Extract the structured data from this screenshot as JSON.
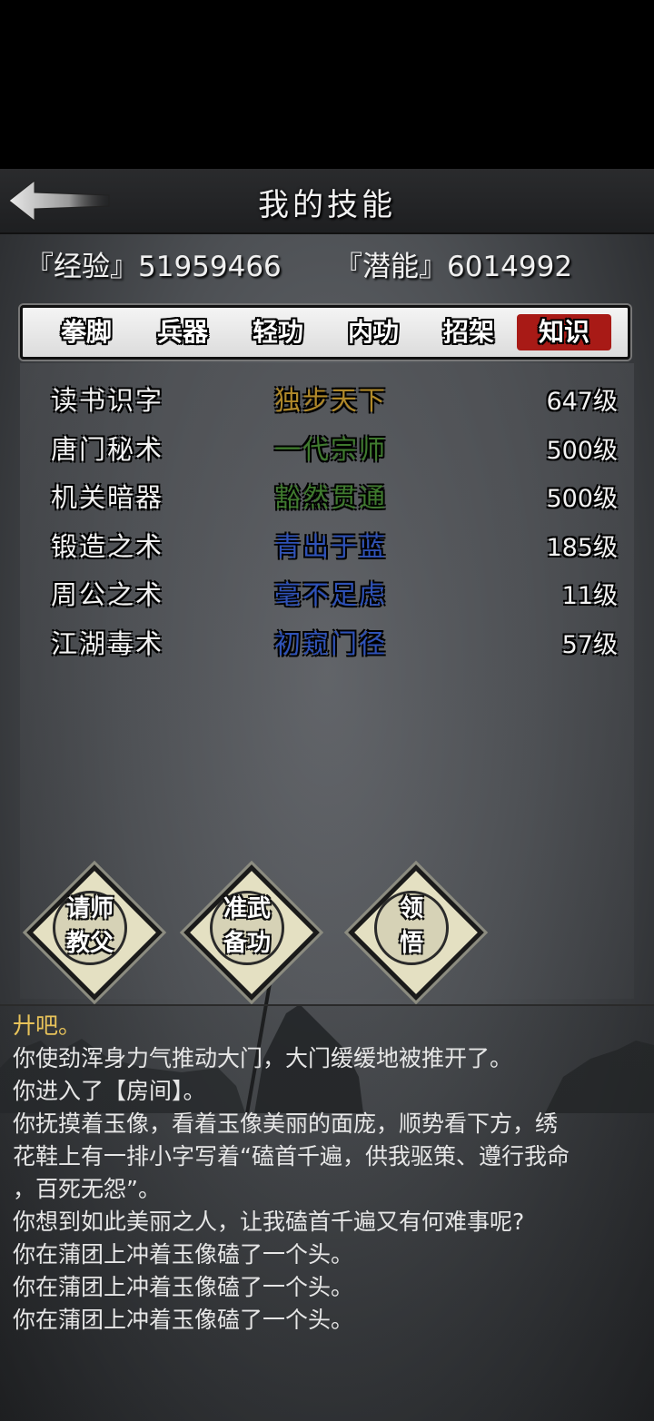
{
  "header": {
    "title": "我的技能"
  },
  "stats": {
    "experience": "『经验』51959466",
    "potential": "『潜能』6014992"
  },
  "tabs": [
    {
      "label": "拳脚",
      "active": false
    },
    {
      "label": "兵器",
      "active": false
    },
    {
      "label": "轻功",
      "active": false
    },
    {
      "label": "内功",
      "active": false
    },
    {
      "label": "招架",
      "active": false
    },
    {
      "label": "知识",
      "active": true
    }
  ],
  "skills": [
    {
      "name": "读书识字",
      "rank": "独步天下",
      "rank_color": "#b0892a",
      "level": "647级"
    },
    {
      "name": "唐门秘术",
      "rank": "一代宗师",
      "rank_color": "#3f7a2e",
      "level": "500级"
    },
    {
      "name": "机关暗器",
      "rank": "豁然贯通",
      "rank_color": "#3f7a2e",
      "level": "500级"
    },
    {
      "name": "锻造之术",
      "rank": "青出于蓝",
      "rank_color": "#2f52b8",
      "level": "185级"
    },
    {
      "name": "周公之术",
      "rank": "毫不足虑",
      "rank_color": "#2f52b8",
      "level": "11级"
    },
    {
      "name": "江湖毒术",
      "rank": "初窥门径",
      "rank_color": "#2f52b8",
      "level": "57级"
    }
  ],
  "actions": [
    {
      "line1": "请师",
      "line2": "教父"
    },
    {
      "line1": "准武",
      "line2": "备功"
    },
    {
      "line1": "领",
      "line2": "悟"
    }
  ],
  "log": [
    "廾吧。",
    "你使劲浑身力气推动大门，大门缓缓地被推开了。",
    "你进入了【房间】。",
    "你抚摸着玉像，看着玉像美丽的面庞，顺势看下方，绣",
    "花鞋上有一排小字写着“磕首千遍，供我驱策、遵行我命",
    "，百死无怨”。",
    "你想到如此美丽之人，让我磕首千遍又有何难事呢?",
    "你在蒲团上冲着玉像磕了一个头。",
    "你在蒲团上冲着玉像磕了一个头。",
    "你在蒲团上冲着玉像磕了一个头。"
  ],
  "colors": {
    "active_tab": "#a81a16",
    "log_highlight": "#e7c25a",
    "button_fill": "#e4e0c2"
  }
}
